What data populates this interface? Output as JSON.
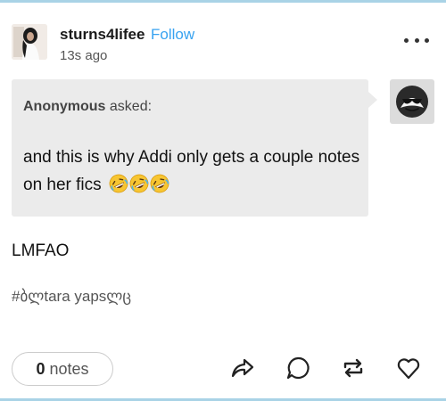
{
  "post": {
    "username": "sturns4lifee",
    "follow_label": "Follow",
    "timestamp": "13s ago",
    "more_icon": "more-dots-icon",
    "ask": {
      "asker": "Anonymous",
      "asked_label": "asked:",
      "question": "and this is why Addi only gets a couple notes on her fics",
      "emoji": "rolling-on-floor-laughing",
      "emoji_count": 3
    },
    "body": "LMFAO",
    "tag": "#ბლtara yapsლც",
    "footer": {
      "notes_count": "0",
      "notes_label": "notes",
      "actions": [
        "share-icon",
        "reply-icon",
        "reblog-icon",
        "heart-icon"
      ]
    }
  },
  "colors": {
    "follow": "#37a2f0",
    "ask_background": "#ebebeb",
    "frame_border": "#a9d3e6"
  }
}
